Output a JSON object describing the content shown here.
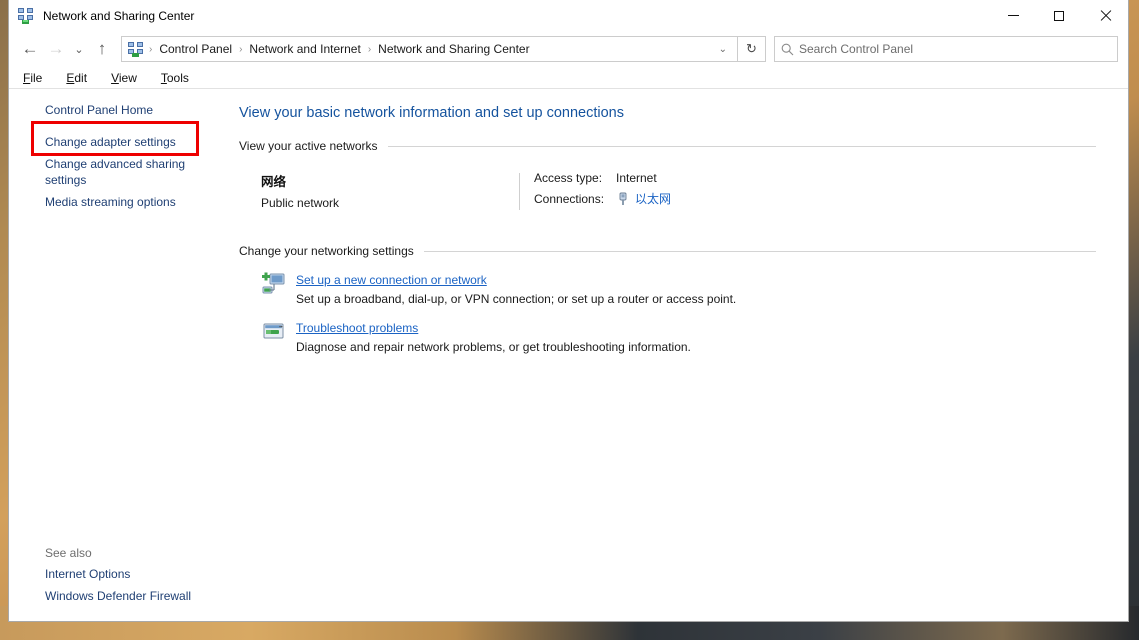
{
  "window": {
    "title": "Network and Sharing Center",
    "icon": "network-sharing-icon",
    "controls": {
      "minimize": "minimize-button",
      "maximize": "maximize-button",
      "close": "close-button"
    }
  },
  "navbar": {
    "back": "←",
    "forward": "→",
    "recent": "⌄",
    "up": "↑",
    "refresh": "↻",
    "dropdown": "⌄",
    "breadcrumbs": [
      {
        "label": "Control Panel"
      },
      {
        "label": "Network and Internet"
      },
      {
        "label": "Network and Sharing Center"
      }
    ],
    "separator": "›",
    "search": {
      "placeholder": "Search Control Panel",
      "value": "",
      "icon": "search-icon"
    }
  },
  "menubar": {
    "items": [
      {
        "accel": "F",
        "rest": "ile"
      },
      {
        "accel": "E",
        "rest": "dit"
      },
      {
        "accel": "V",
        "rest": "iew"
      },
      {
        "accel": "T",
        "rest": "ools"
      }
    ]
  },
  "sidebar": {
    "items": [
      {
        "label": "Control Panel Home"
      },
      {
        "label": "Change adapter settings"
      },
      {
        "label": "Change advanced sharing settings"
      },
      {
        "label": "Media streaming options"
      }
    ],
    "see_also": {
      "title": "See also",
      "items": [
        {
          "label": "Internet Options"
        },
        {
          "label": "Windows Defender Firewall"
        }
      ]
    }
  },
  "highlight": {
    "target": "Change adapter settings",
    "color": "#ee0000"
  },
  "main": {
    "heading": "View your basic network information and set up connections",
    "active_networks": {
      "section_title": "View your active networks",
      "network": {
        "name": "网络",
        "type": "Public network",
        "access_type_label": "Access type:",
        "access_type_value": "Internet",
        "connections_label": "Connections:",
        "connections_value": "以太网",
        "connections_icon": "ethernet-icon"
      }
    },
    "networking_settings": {
      "section_title": "Change your networking settings",
      "tasks": [
        {
          "icon": "new-connection-icon",
          "link": "Set up a new connection or network",
          "description": "Set up a broadband, dial-up, or VPN connection; or set up a router or access point."
        },
        {
          "icon": "troubleshoot-icon",
          "link": "Troubleshoot problems",
          "description": "Diagnose and repair network problems, or get troubleshooting information."
        }
      ]
    }
  },
  "colors": {
    "heading_blue": "#15539e",
    "link_blue": "#1b63c4",
    "nav_blue": "#1f3f73",
    "highlight_red": "#ee0000"
  }
}
